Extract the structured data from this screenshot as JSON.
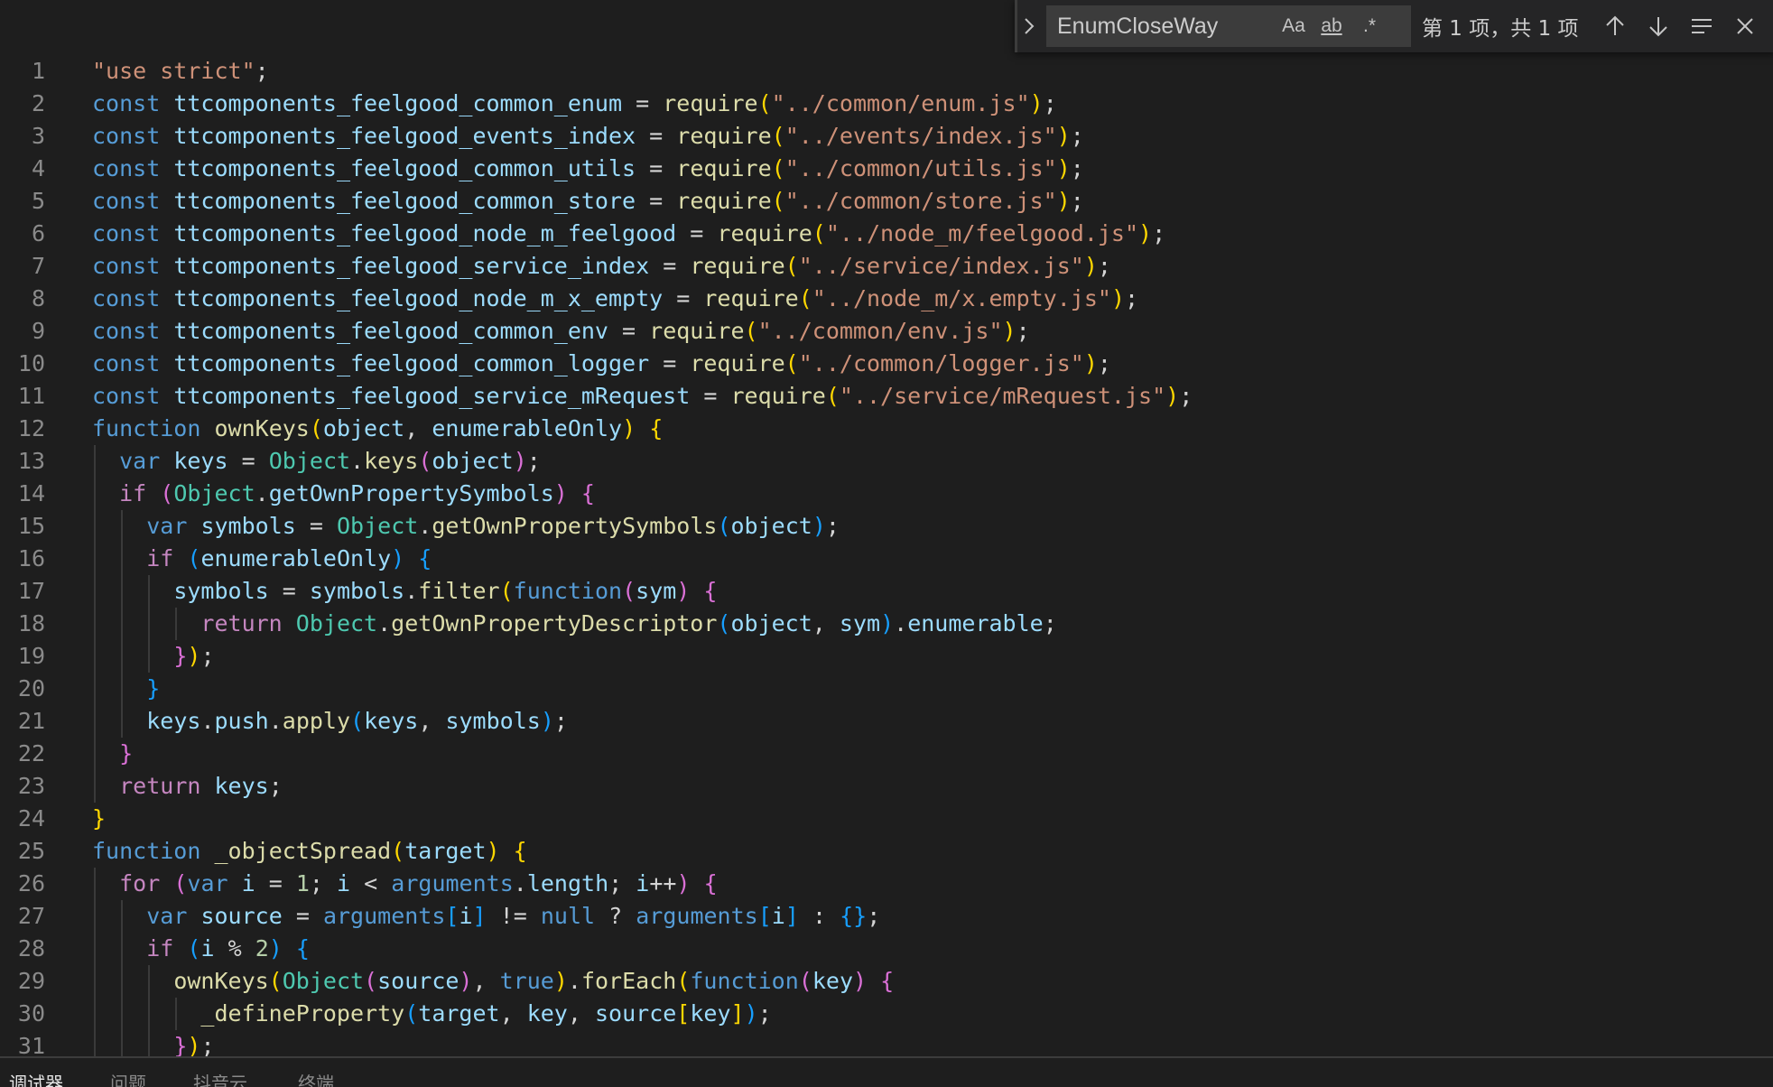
{
  "find_widget": {
    "query": "EnumCloseWay",
    "match_case_label": "Aa",
    "whole_word_label": "ab",
    "regex_label": ".*",
    "result_count": "第 1 项，共 1 项"
  },
  "panel_tabs": [
    "调试器",
    "问题",
    "抖音云",
    "终端"
  ],
  "colors": {
    "keyword": "#569cd6",
    "control": "#c586c0",
    "variable": "#9cdcfe",
    "function": "#dcdcaa",
    "string": "#ce9178",
    "number": "#b5cea8",
    "bracket_level_1": "#ffd700",
    "bracket_level_2": "#da70d6",
    "bracket_level_3": "#179fff"
  },
  "code_lines": [
    "\"use strict\";",
    "const ttcomponents_feelgood_common_enum = require(\"../common/enum.js\");",
    "const ttcomponents_feelgood_events_index = require(\"../events/index.js\");",
    "const ttcomponents_feelgood_common_utils = require(\"../common/utils.js\");",
    "const ttcomponents_feelgood_common_store = require(\"../common/store.js\");",
    "const ttcomponents_feelgood_node_m_feelgood = require(\"../node_m/feelgood.js\");",
    "const ttcomponents_feelgood_service_index = require(\"../service/index.js\");",
    "const ttcomponents_feelgood_node_m_x_empty = require(\"../node_m/x.empty.js\");",
    "const ttcomponents_feelgood_common_env = require(\"../common/env.js\");",
    "const ttcomponents_feelgood_common_logger = require(\"../common/logger.js\");",
    "const ttcomponents_feelgood_service_mRequest = require(\"../service/mRequest.js\");",
    "function ownKeys(object, enumerableOnly) {",
    "  var keys = Object.keys(object);",
    "  if (Object.getOwnPropertySymbols) {",
    "    var symbols = Object.getOwnPropertySymbols(object);",
    "    if (enumerableOnly) {",
    "      symbols = symbols.filter(function(sym) {",
    "        return Object.getOwnPropertyDescriptor(object, sym).enumerable;",
    "      });",
    "    }",
    "    keys.push.apply(keys, symbols);",
    "  }",
    "  return keys;",
    "}",
    "function _objectSpread(target) {",
    "  for (var i = 1; i < arguments.length; i++) {",
    "    var source = arguments[i] != null ? arguments[i] : {};",
    "    if (i % 2) {",
    "      ownKeys(Object(source), true).forEach(function(key) {",
    "        _defineProperty(target, key, source[key]);",
    "      });"
  ]
}
